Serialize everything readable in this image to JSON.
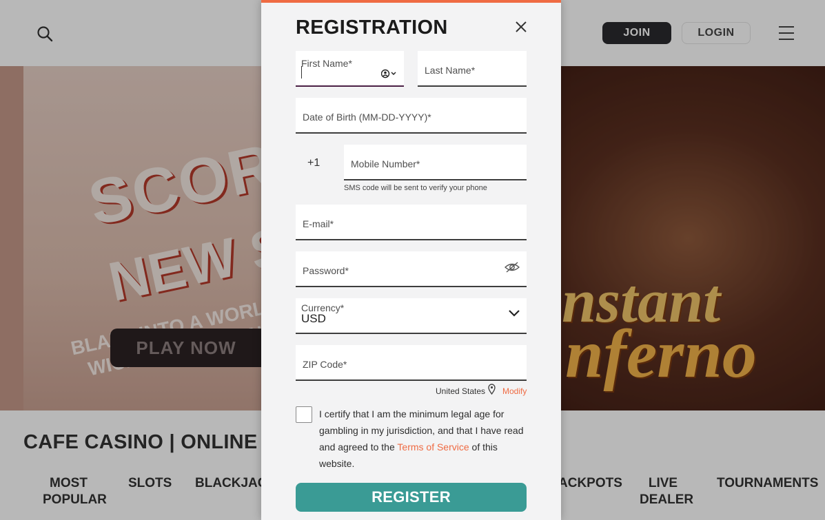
{
  "header": {
    "join_label": "JOIN",
    "login_label": "LOGIN",
    "icons": [
      "search-icon",
      "hamburger-menu-icon"
    ]
  },
  "hero": {
    "headline_line1": "SCORCHI",
    "headline_line2": "NEW SL",
    "subline1": "BLAZE INTO A WORLD OF RED-H",
    "subline2": "WICKED WILDS AND BLISTER",
    "art_line1": "nstant",
    "art_line2": "nferno",
    "play_label": "PLAY NOW"
  },
  "below": {
    "title": "CAFE CASINO | ONLINE CASINO GAME",
    "categories": [
      {
        "label": "MOST\nPOPULAR"
      },
      {
        "label": "SLOTS"
      },
      {
        "label": "BLACKJACK"
      },
      {
        "label": "ACKPOTS"
      },
      {
        "label": "LIVE\nDEALER"
      },
      {
        "label": "TOURNAMENTS"
      }
    ]
  },
  "registration": {
    "title": "REGISTRATION",
    "first_name_label": "First Name*",
    "last_name_label": "Last Name*",
    "dob_label": "Date of Birth (MM-DD-YYYY)*",
    "phone_prefix": "+1",
    "mobile_label": "Mobile Number*",
    "sms_hint": "SMS code will be sent to verify your phone",
    "email_label": "E-mail*",
    "password_label": "Password*",
    "currency_label": "Currency*",
    "currency_value": "USD",
    "zip_label": "ZIP Code*",
    "country": "United States",
    "modify_label": "Modify",
    "cert_text_1": "I certify that I am the minimum legal age for gambling in my jurisdiction, and that I have read and agreed to the ",
    "terms_link": "Terms of Service",
    "cert_text_2": " of this website.",
    "register_label": "REGISTER",
    "colors": {
      "accent_orange": "#ef6b43",
      "register_teal": "#3a9b95",
      "join_dark": "#2a2a2e"
    }
  }
}
